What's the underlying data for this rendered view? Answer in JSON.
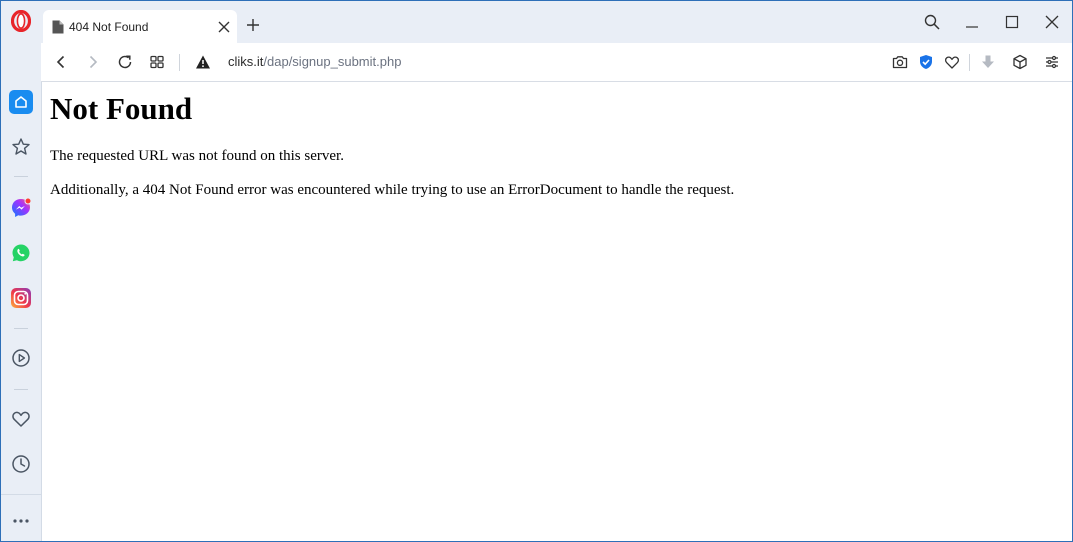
{
  "tab": {
    "title": "404 Not Found"
  },
  "address_bar": {
    "domain": "cliks.it",
    "path": "/dap/signup_submit.php"
  },
  "page": {
    "heading": "Not Found",
    "paragraph_1": "The requested URL was not found on this server.",
    "paragraph_2": "Additionally, a 404 Not Found error was encountered while trying to use an ErrorDocument to handle the request."
  },
  "sidebar": {
    "items": [
      "home-icon",
      "speed-dial-icon",
      "messenger-icon",
      "whatsapp-icon",
      "instagram-icon",
      "player-icon",
      "bookmarks-icon",
      "history-icon",
      "more-icon"
    ]
  },
  "colors": {
    "opera_red": "#e8252a",
    "accent_blue": "#1a8cf0",
    "sidebar_bg": "#e9eef6",
    "vpn_blue": "#1a73e8"
  }
}
